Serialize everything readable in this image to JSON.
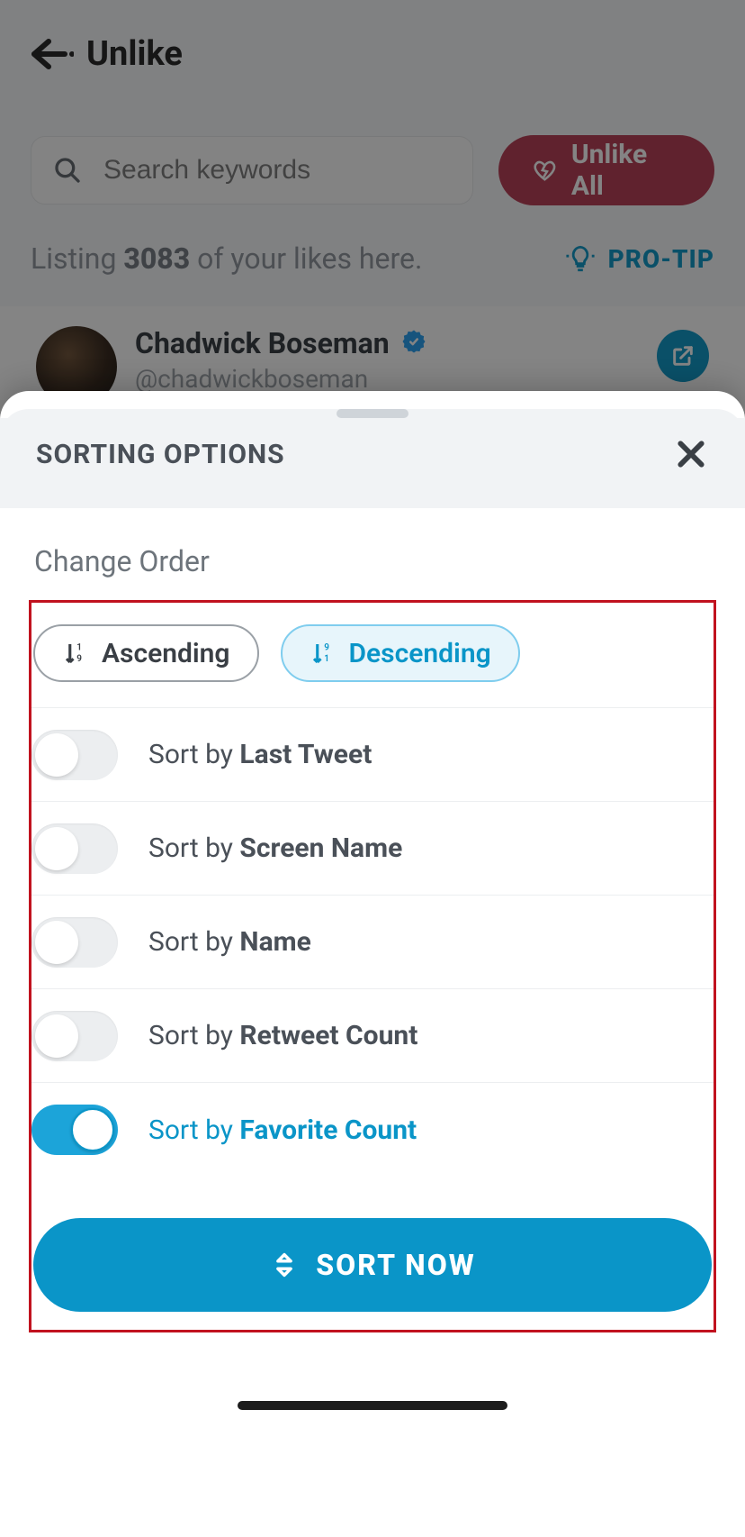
{
  "header": {
    "title": "Unlike"
  },
  "search": {
    "placeholder": "Search keywords"
  },
  "unlike_all_label": "Unlike All",
  "listing": {
    "prefix": "Listing ",
    "count": "3083",
    "suffix": " of your likes here."
  },
  "protip_label": "PRO-TIP",
  "feed": {
    "display_name": "Chadwick Boseman",
    "handle": "@chadwickboseman"
  },
  "sheet": {
    "title": "SORTING OPTIONS",
    "change_order_label": "Change Order",
    "order": {
      "ascending_label": "Ascending",
      "descending_label": "Descending",
      "selected": "descending"
    },
    "options": [
      {
        "prefix": "Sort by ",
        "strong": "Last Tweet",
        "on": false
      },
      {
        "prefix": "Sort by ",
        "strong": "Screen Name",
        "on": false
      },
      {
        "prefix": "Sort by ",
        "strong": "Name",
        "on": false
      },
      {
        "prefix": "Sort by ",
        "strong": "Retweet Count",
        "on": false
      },
      {
        "prefix": "Sort by ",
        "strong": "Favorite Count",
        "on": true
      }
    ],
    "sort_now_label": "SORT NOW"
  },
  "colors": {
    "accent": "#0a95c8",
    "danger": "#b5324b",
    "highlight_box": "#c1121f"
  }
}
